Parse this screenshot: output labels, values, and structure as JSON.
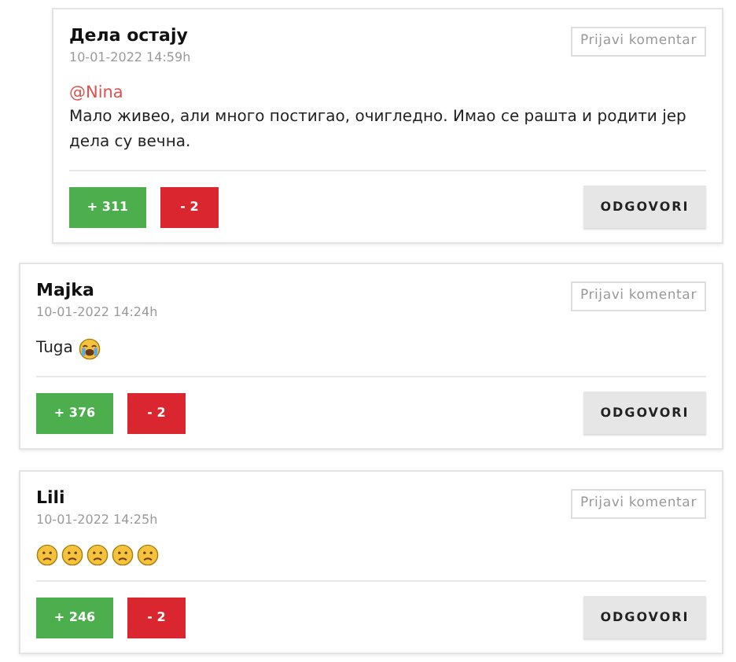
{
  "comments": [
    {
      "author": "Дела остају",
      "date": "10-01-2022 14:59h",
      "is_reply": true,
      "mention": "@Nina",
      "text": "Мало живео, али много постигао, очигледно. Имао се рашта и родити јер дела су вечна.",
      "report": "Prijavi komentar",
      "upvotes": "+ 311",
      "downvotes": "- 2",
      "reply": "ODGOVORI"
    },
    {
      "author": "Majka",
      "date": "10-01-2022 14:24h",
      "is_reply": false,
      "text": "Tuga",
      "emojis": [
        {
          "kind": "crying"
        }
      ],
      "report": "Prijavi komentar",
      "upvotes": "+ 376",
      "downvotes": "- 2",
      "reply": "ODGOVORI"
    },
    {
      "author": "Lili",
      "date": "10-01-2022 14:25h",
      "is_reply": false,
      "emojis": [
        {
          "kind": "sad"
        },
        {
          "kind": "sad"
        },
        {
          "kind": "sad"
        },
        {
          "kind": "sad"
        },
        {
          "kind": "sad"
        }
      ],
      "report": "Prijavi komentar",
      "upvotes": "+ 246",
      "downvotes": "- 2",
      "reply": "ODGOVORI"
    }
  ]
}
